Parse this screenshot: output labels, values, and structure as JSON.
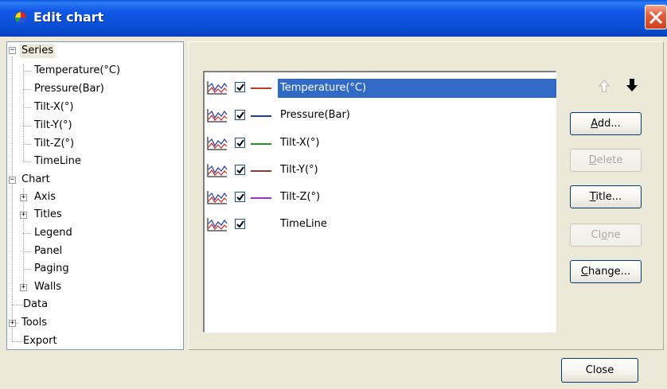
{
  "window": {
    "title": "Edit chart"
  },
  "tree": {
    "series_label": "Series",
    "series_items": [
      "Temperature(°C)",
      "Pressure(Bar)",
      "Tilt-X(°)",
      "Tilt-Y(°)",
      "Tilt-Z(°)",
      "TimeLine"
    ],
    "chart_label": "Chart",
    "chart_items": [
      "Axis",
      "Titles",
      "Legend",
      "Panel",
      "Paging",
      "Walls"
    ],
    "data_label": "Data",
    "tools_label": "Tools",
    "export_label": "Export"
  },
  "series_list": [
    {
      "label": "Temperature(°C)",
      "color": "#c0392b",
      "checked": true,
      "selected": true
    },
    {
      "label": "Pressure(Bar)",
      "color": "#1f3ba8",
      "checked": true,
      "selected": false
    },
    {
      "label": "Tilt-X(°)",
      "color": "#2e8b2e",
      "checked": true,
      "selected": false
    },
    {
      "label": "Tilt-Y(°)",
      "color": "#8b3a3a",
      "checked": true,
      "selected": false
    },
    {
      "label": "Tilt-Z(°)",
      "color": "#9b30c8",
      "checked": true,
      "selected": false
    },
    {
      "label": "TimeLine",
      "color": "",
      "checked": true,
      "selected": false
    }
  ],
  "buttons": {
    "add": {
      "pre": "",
      "ul": "A",
      "post": "dd..."
    },
    "delete": {
      "pre": "",
      "ul": "D",
      "post": "elete"
    },
    "title": {
      "pre": "",
      "ul": "T",
      "post": "itle..."
    },
    "clone": {
      "pre": "Cl",
      "ul": "o",
      "post": "ne"
    },
    "change": {
      "pre": "",
      "ul": "C",
      "post": "hange..."
    },
    "close": "Close"
  },
  "icons": {
    "app": "chart-app-icon",
    "close": "close-icon",
    "move_up": "arrow-up-icon",
    "move_down": "arrow-down-icon",
    "series": "line-chart-icon",
    "checkbox": "checkmark-icon"
  }
}
